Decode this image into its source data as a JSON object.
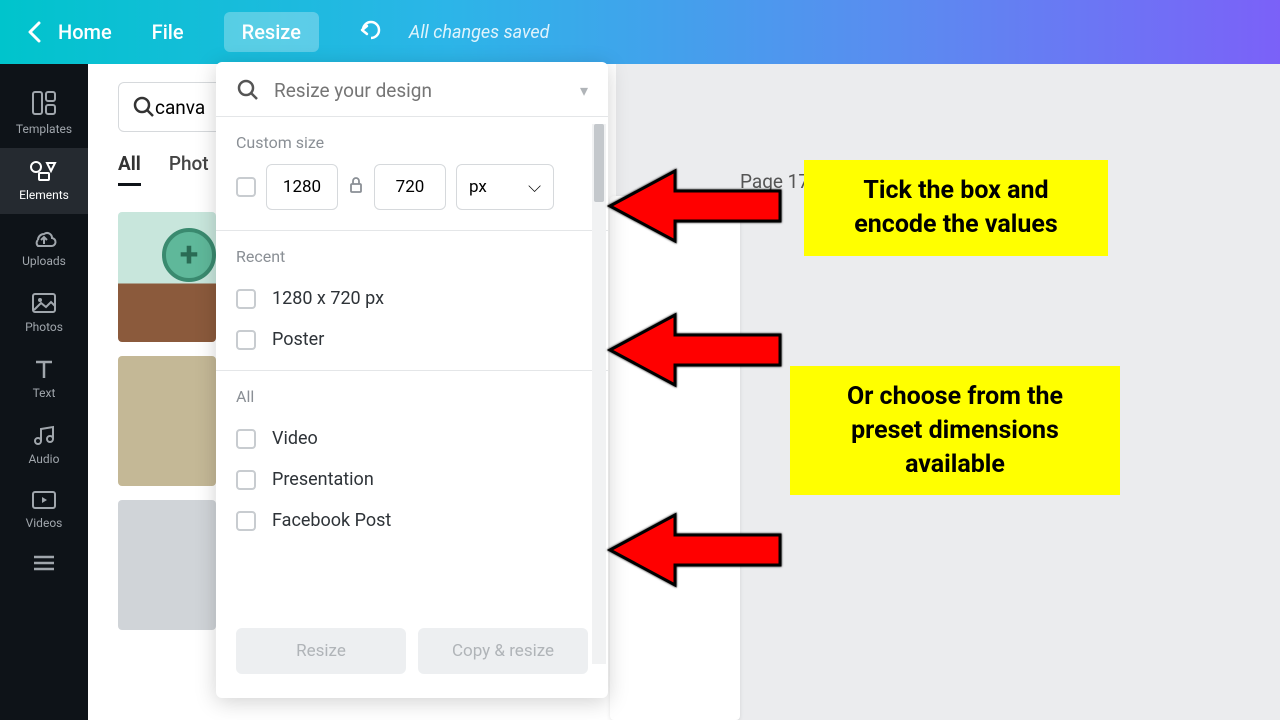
{
  "topbar": {
    "home": "Home",
    "file": "File",
    "resize": "Resize",
    "saved": "All changes saved"
  },
  "sidebar": {
    "items": [
      {
        "label": "Templates"
      },
      {
        "label": "Elements"
      },
      {
        "label": "Uploads"
      },
      {
        "label": "Photos"
      },
      {
        "label": "Text"
      },
      {
        "label": "Audio"
      },
      {
        "label": "Videos"
      }
    ]
  },
  "search": {
    "value": "canva",
    "tabs": {
      "all": "All",
      "photos": "Phot"
    }
  },
  "canvas": {
    "page_label": "Page 17"
  },
  "popup": {
    "placeholder": "Resize your design",
    "custom_label": "Custom size",
    "width": "1280",
    "height": "720",
    "unit": "px",
    "recent_label": "Recent",
    "recent_items": [
      "1280 x 720 px",
      "Poster"
    ],
    "all_label": "All",
    "all_items": [
      "Video",
      "Presentation",
      "Facebook Post"
    ],
    "resize_btn": "Resize",
    "copy_btn": "Copy & resize"
  },
  "callouts": {
    "c1": "Tick the box and encode the values",
    "c2": "Or choose from the preset dimensions available"
  }
}
